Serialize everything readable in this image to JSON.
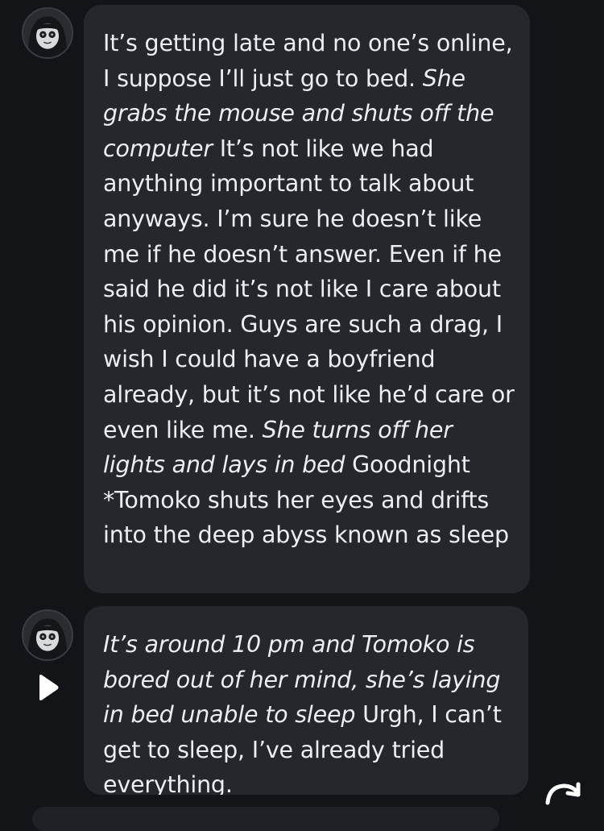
{
  "messages": [
    {
      "segments": [
        {
          "text": "It’s getting late and no one’s online, I suppose I’ll just go to bed. ",
          "italic": false
        },
        {
          "text": "She grabs the mouse and shuts off the computer",
          "italic": true
        },
        {
          "text": " It’s not like we had anything important to talk about anyways. I’m sure he doesn’t like me if he doesn’t answer. Even if he said he did it’s not like I care about his opinion. Guys are such a drag, I wish I could have a boyfriend already, but it’s not like he’d care or even like me. ",
          "italic": false
        },
        {
          "text": "She turns off her lights and lays in bed",
          "italic": true
        },
        {
          "text": " Goodnight *Tomoko shuts her eyes and drifts into the deep abyss known as sleep",
          "italic": false
        }
      ]
    },
    {
      "segments": [
        {
          "text": "It’s around 10 pm and Tomoko is bored out of her mind, she’s laying in bed unable to sleep",
          "italic": true
        },
        {
          "text": " Urgh, I can’t get to sleep, I’ve already tried everything.",
          "italic": false
        }
      ]
    }
  ],
  "icons": {
    "avatar": "character-avatar-icon",
    "play": "play-icon",
    "regenerate": "regenerate-icon"
  },
  "colors": {
    "background": "#121418",
    "bubble": "#25272c",
    "text": "#eceef2",
    "accent": "#ffffff"
  }
}
